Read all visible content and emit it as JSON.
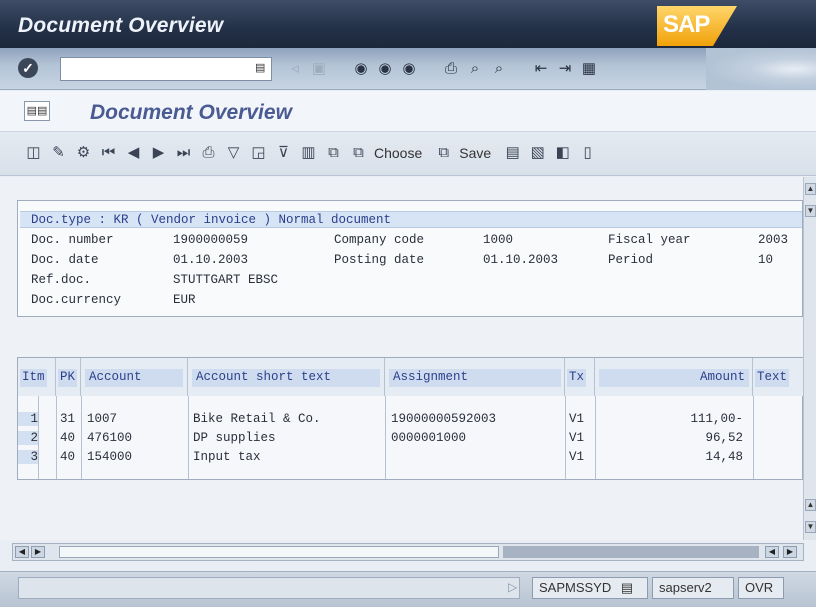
{
  "window": {
    "title": "Document Overview",
    "logo": "SAP"
  },
  "colors": {
    "titlebar": "#24324a",
    "accent": "#4a5a92",
    "highlight": "#d7e4f6",
    "brand": "#f0a10a"
  },
  "system_toolbar": {
    "command_field_value": "",
    "icons": [
      "enter-icon",
      "save-icon",
      "back-icon",
      "exit-icon",
      "cancel-icon",
      "print-icon",
      "find-icon",
      "find-next-icon",
      "first-page-icon",
      "prev-page-icon",
      "create-session-icon",
      "shortcut-icon"
    ]
  },
  "screen": {
    "title": "Document Overview"
  },
  "app_toolbar": {
    "choose_label": "Choose",
    "save_label": "Save"
  },
  "header": {
    "doc_type_line": "Doc.type : KR ( Vendor invoice ) Normal document",
    "fields": [
      {
        "label": "Doc. number",
        "value": "1900000059"
      },
      {
        "label": "Doc. date",
        "value": "01.10.2003"
      },
      {
        "label": "Ref.doc.",
        "value": "STUTTGART EBSC"
      },
      {
        "label": "Doc.currency",
        "value": "EUR"
      }
    ],
    "fields2": [
      {
        "label": "Company code",
        "value": "1000"
      },
      {
        "label": "Posting date",
        "value": "01.10.2003"
      }
    ],
    "fields3": [
      {
        "label": "Fiscal year",
        "value": "2003"
      },
      {
        "label": "Period",
        "value": "10"
      }
    ]
  },
  "table": {
    "columns": [
      "Itm",
      "PK",
      "Account",
      "Account short text",
      "Assignment",
      "Tx",
      "Amount",
      "Text"
    ],
    "rows": [
      {
        "itm": "1",
        "pk": "31",
        "account": "1007",
        "short_text": "Bike Retail & Co.",
        "assignment": "19000000592003",
        "tx": "V1",
        "amount": "111,00-",
        "text": ""
      },
      {
        "itm": "2",
        "pk": "40",
        "account": "476100",
        "short_text": "DP supplies",
        "assignment": "0000001000",
        "tx": "V1",
        "amount": "96,52",
        "text": ""
      },
      {
        "itm": "3",
        "pk": "40",
        "account": "154000",
        "short_text": "Input tax",
        "assignment": "",
        "tx": "V1",
        "amount": "14,48",
        "text": ""
      }
    ]
  },
  "statusbar": {
    "program": "SAPMSSYD",
    "server": "sapserv2",
    "mode": "OVR"
  }
}
